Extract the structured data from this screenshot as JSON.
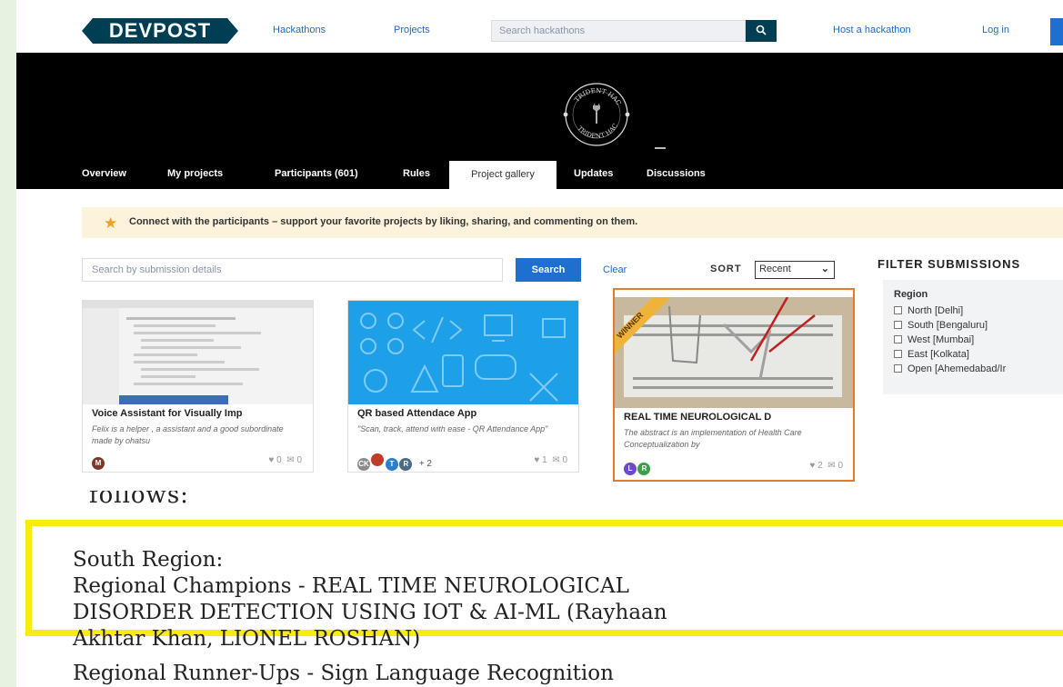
{
  "header": {
    "logo_text": "DEVPOST",
    "nav": [
      "Hackathons",
      "Projects"
    ],
    "search_placeholder": "Search hackathons",
    "host_label": "Host a hackathon",
    "login_label": "Log in"
  },
  "hero": {
    "emblem_text_top": "TRIDENT HACKS",
    "emblem_text_bottom": "TRIDENT HACKS"
  },
  "tabs": [
    "Overview",
    "My projects",
    "Participants (601)",
    "Rules",
    "Project gallery",
    "Updates",
    "Discussions"
  ],
  "active_tab": "Project gallery",
  "notice": "Connect with the participants – support your favorite projects by liking, sharing, and commenting on them.",
  "gallery_search": {
    "placeholder": "Search by submission details",
    "button": "Search",
    "clear": "Clear",
    "sort_label": "SORT",
    "sort_value": "Recent"
  },
  "filter": {
    "title": "FILTER SUBMISSIONS",
    "region_title": "Region",
    "regions": [
      "North [Delhi]",
      "South [Bengaluru]",
      "West [Mumbai]",
      "East [Kolkata]",
      "Open [Ahemedabad/Ir"
    ]
  },
  "projects": [
    {
      "title": "Voice Assistant for Visually Imp",
      "desc": "Felix is a helper , a assistant and a good subordinate made by ohatsu",
      "avatars": [
        "M"
      ],
      "extra": "",
      "likes": "0",
      "comments": "0"
    },
    {
      "title": "QR based Attendace App",
      "desc": "\"Scan, track, attend with ease - QR Attendance App\"",
      "avatars": [
        "CK",
        "",
        "T",
        "R"
      ],
      "extra": "+ 2",
      "likes": "1",
      "comments": "0"
    },
    {
      "title": "REAL TIME NEUROLOGICAL D",
      "desc": "The abstract is an implementation of Health Care Conceptualization by",
      "avatars": [
        "L",
        "R"
      ],
      "extra": "",
      "likes": "2",
      "comments": "0",
      "badge": "WINNER"
    }
  ],
  "article": {
    "cut_top": "follows:",
    "lines": [
      "South Region:",
      "Regional Champions - REAL TIME NEUROLOGICAL",
      "DISORDER DETECTION USING IOT & AI-ML (Rayhaan",
      "Akhtar Khan, LIONEL ROSHAN)"
    ],
    "cut_bottom": "Regional Runner-Ups - Sign Language Recognition"
  },
  "colors": {
    "brand": "#003e54",
    "link": "#1c6cc2",
    "primary_button": "#1f6fd1",
    "notice_bg": "#fdf2dc",
    "winner_border": "#e07b30",
    "highlight": "#f7eb12"
  }
}
